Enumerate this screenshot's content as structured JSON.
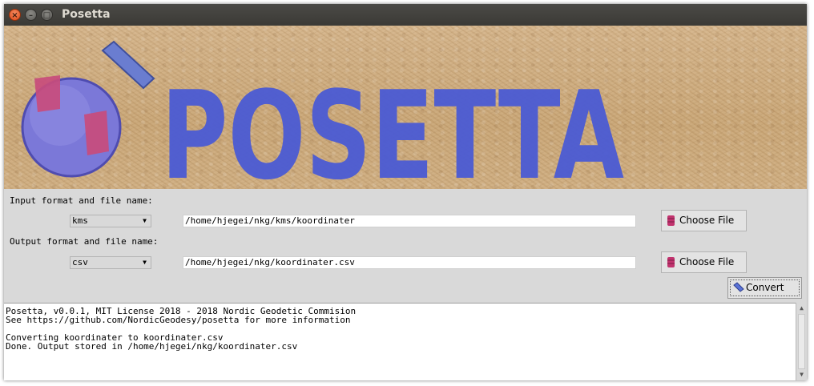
{
  "window": {
    "title": "Posetta"
  },
  "banner": {
    "logo_text": "POSETTA"
  },
  "input": {
    "label": "Input format and file name:",
    "format": "kms",
    "path": "/home/hjegei/nkg/kms/koordinater",
    "choose_label": "Choose File"
  },
  "output": {
    "label": "Output format and file name:",
    "format": "csv",
    "path": "/home/hjegei/nkg/koordinater.csv",
    "choose_label": "Choose File"
  },
  "convert": {
    "label": "Convert"
  },
  "log": {
    "lines": [
      "Posetta, v0.0.1, MIT License 2018 - 2018 Nordic Geodetic Commision",
      "See https://github.com/NordicGeodesy/posetta for more information",
      "",
      "Converting koordinater to koordinater.csv",
      "Done. Output stored in /home/hjegei/nkg/koordinater.csv"
    ]
  },
  "colors": {
    "logo_blue": "#4b5bd4",
    "logo_magenta": "#c04a7a",
    "sand": "#cfae82"
  }
}
